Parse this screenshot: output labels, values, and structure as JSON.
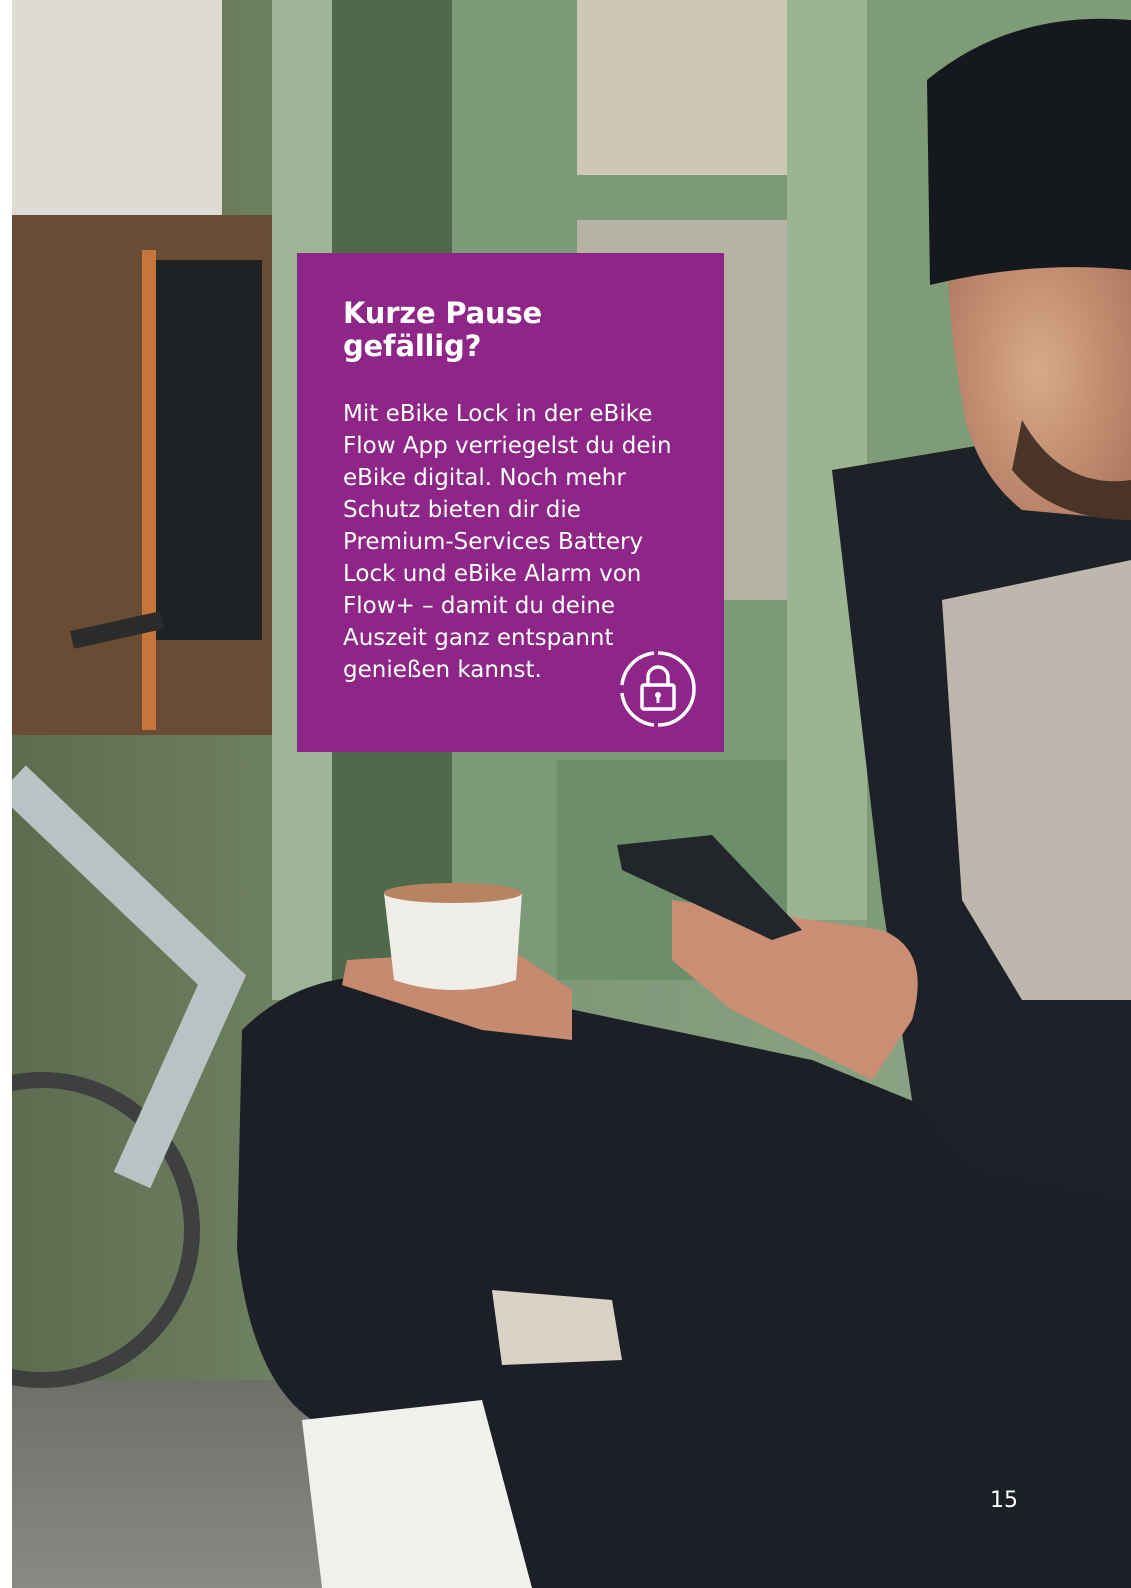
{
  "info_box": {
    "title": "Kurze Pause gefällig?",
    "body": "Mit eBike Lock in der eBike Flow App verriegelst du dein eBike digital. Noch mehr Schutz bieten dir die Premium-Services Battery Lock und eBike Alarm von Flow+ – damit du deine Auszeit ganz entspannt genießen kannst.",
    "icon": "lock-icon",
    "background_color": "#8e2688"
  },
  "photo": {
    "icon": "photo-placeholder"
  },
  "page_number": "15"
}
